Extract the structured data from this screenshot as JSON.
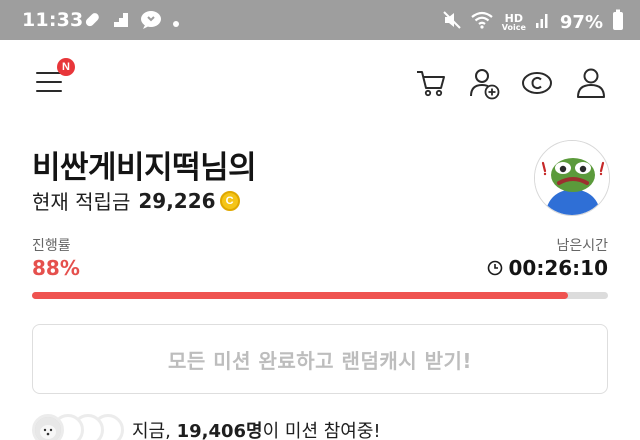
{
  "status_bar": {
    "time": "11:33",
    "battery": "97%",
    "hd": "HD",
    "voice": "Voice"
  },
  "header": {
    "menu_badge": "N",
    "icons": [
      "cart-icon",
      "add-friend-icon",
      "cash-coin-icon",
      "profile-icon"
    ]
  },
  "profile": {
    "nickname": "비싼게비지떡님의",
    "balance_label": "현재 적립금",
    "balance_value": "29,226",
    "coin_symbol": "C"
  },
  "progress": {
    "label": "진행률",
    "value_text": "88%",
    "fraction": 0.93,
    "remaining_label": "남은시간",
    "remaining_value": "00:26:10"
  },
  "cta": {
    "label": "모든 미션 완료하고 랜덤캐시 받기!"
  },
  "participants": {
    "prefix": "지금,",
    "count": "19,406명",
    "suffix": "이 미션 참여중!"
  },
  "colors": {
    "accent": "#ef5350",
    "progress_text": "#e5504d",
    "status_bar": "#9e9e9e",
    "badge": "#e8363a",
    "coin": "#f5c518"
  }
}
